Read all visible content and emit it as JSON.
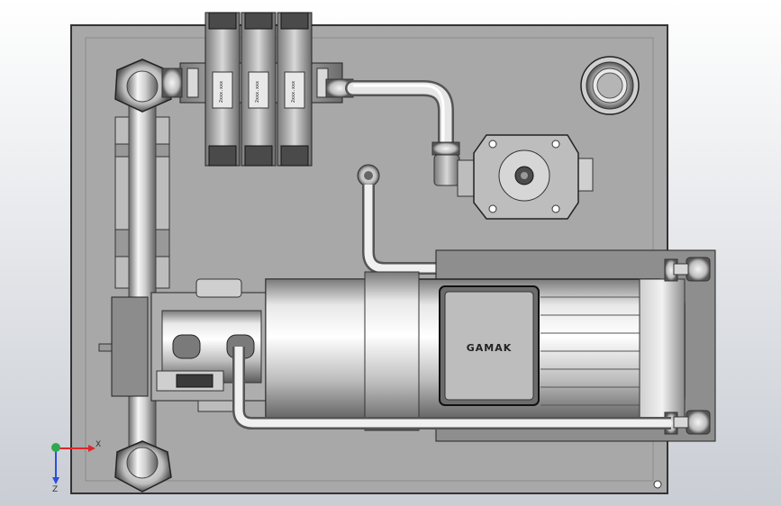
{
  "motor": {
    "brand": "GAMAK"
  },
  "triad": {
    "x_label": "X",
    "y_label": "Y",
    "z_label": "Z"
  },
  "valves": [
    {
      "label": "2xxx.xxx"
    },
    {
      "label": "2xxx.xxx"
    },
    {
      "label": "2xxx.xxx"
    }
  ],
  "colors": {
    "background_top": "#ffffff",
    "background_bottom": "#c9cdd4",
    "plate": "#a9a9a9",
    "plate_edge": "#333333",
    "steel_light": "#f4f4f4",
    "steel_mid": "#b8b8b8",
    "steel_dark": "#5a5a5a",
    "axis_x": "#e0262b",
    "axis_y": "#2fa84f",
    "axis_z": "#2b4fd8"
  }
}
